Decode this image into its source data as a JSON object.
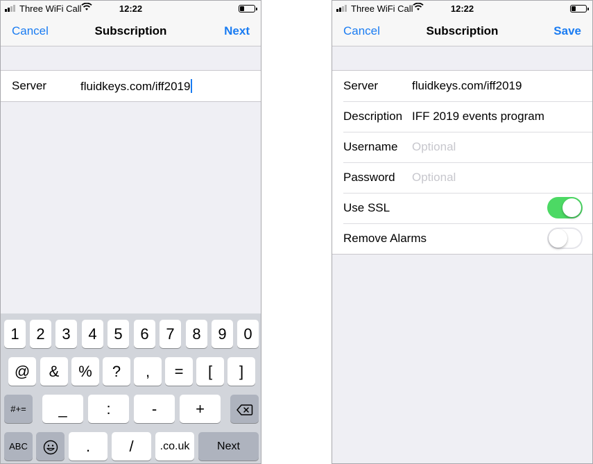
{
  "left": {
    "status": {
      "carrier": "Three WiFi Call",
      "time": "12:22"
    },
    "nav": {
      "cancel": "Cancel",
      "title": "Subscription",
      "next": "Next"
    },
    "form": {
      "server_label": "Server",
      "server_value": "fluidkeys.com/iff2019"
    },
    "keyboard": {
      "row1": [
        "1",
        "2",
        "3",
        "4",
        "5",
        "6",
        "7",
        "8",
        "9",
        "0"
      ],
      "row2": [
        "@",
        "&",
        "%",
        "?",
        ",",
        "=",
        "[",
        "]"
      ],
      "row3": {
        "mode": "#+=",
        "keys": [
          "_",
          ":",
          "-",
          "+"
        ],
        "delete_icon": "backspace-icon"
      },
      "row4": {
        "abc": "ABC",
        "emoji_icon": "emoji-icon",
        "period": ".",
        "slash": "/",
        "domain": ".co.uk",
        "next": "Next"
      }
    }
  },
  "right": {
    "status": {
      "carrier": "Three WiFi Call",
      "time": "12:22"
    },
    "nav": {
      "cancel": "Cancel",
      "title": "Subscription",
      "save": "Save"
    },
    "form": {
      "server_label": "Server",
      "server_value": "fluidkeys.com/iff2019",
      "description_label": "Description",
      "description_value": "IFF 2019 events program",
      "username_label": "Username",
      "username_placeholder": "Optional",
      "password_label": "Password",
      "password_placeholder": "Optional",
      "ssl_label": "Use SSL",
      "ssl_on": true,
      "alarms_label": "Remove Alarms",
      "alarms_on": false
    }
  },
  "colors": {
    "accent": "#1a7cf2",
    "toggle_on": "#4cd964",
    "background": "#efeff4",
    "keyboard": "#d2d5db"
  }
}
